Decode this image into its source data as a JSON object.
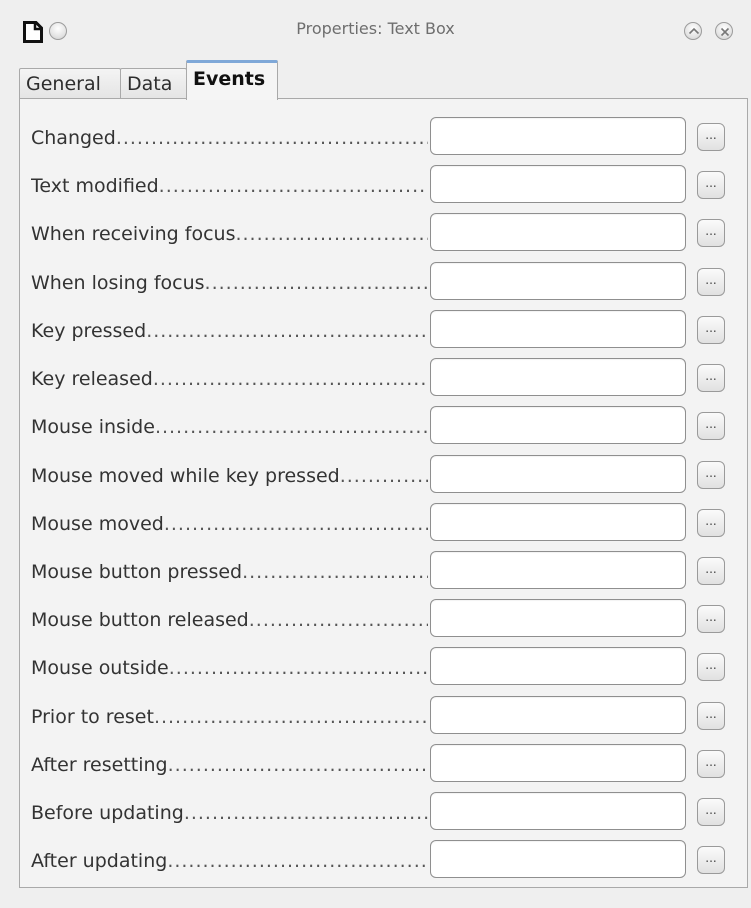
{
  "window": {
    "title": "Properties: Text Box"
  },
  "tabs": [
    {
      "label": "General",
      "active": false
    },
    {
      "label": "Data",
      "active": false
    },
    {
      "label": "Events",
      "active": true
    }
  ],
  "events": [
    {
      "label": "Changed",
      "value": "",
      "button_label": "..."
    },
    {
      "label": "Text modified",
      "value": "",
      "button_label": "..."
    },
    {
      "label": "When receiving focus",
      "value": "",
      "button_label": "..."
    },
    {
      "label": "When losing focus",
      "value": "",
      "button_label": "..."
    },
    {
      "label": "Key pressed",
      "value": "",
      "button_label": "..."
    },
    {
      "label": "Key released",
      "value": "",
      "button_label": "..."
    },
    {
      "label": "Mouse inside",
      "value": "",
      "button_label": "..."
    },
    {
      "label": "Mouse moved while key pressed",
      "value": "",
      "button_label": "..."
    },
    {
      "label": "Mouse moved",
      "value": "",
      "button_label": "..."
    },
    {
      "label": "Mouse button pressed",
      "value": "",
      "button_label": "..."
    },
    {
      "label": "Mouse button released",
      "value": "",
      "button_label": "..."
    },
    {
      "label": "Mouse outside",
      "value": "",
      "button_label": "..."
    },
    {
      "label": "Prior to reset",
      "value": "",
      "button_label": "..."
    },
    {
      "label": "After resetting",
      "value": "",
      "button_label": "..."
    },
    {
      "label": "Before updating",
      "value": "",
      "button_label": "..."
    },
    {
      "label": "After updating",
      "value": "",
      "button_label": "..."
    }
  ],
  "icons": {
    "app": "document-icon",
    "menu": "window-menu-icon",
    "collapse": "chevron-up-icon",
    "close": "close-icon"
  },
  "colors": {
    "active_tab_accent": "#7fa8d8",
    "background": "#efefef"
  }
}
